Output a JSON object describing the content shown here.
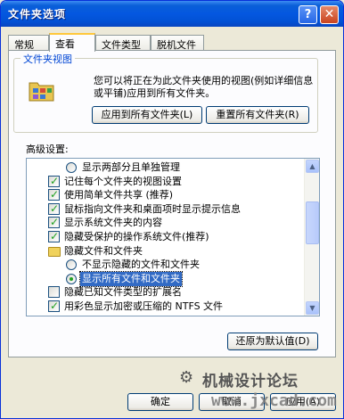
{
  "window": {
    "title": "文件夹选项"
  },
  "titlebar": {
    "help": "?",
    "close": "✕"
  },
  "tabs": [
    "常规",
    "查看",
    "文件类型",
    "脱机文件"
  ],
  "folder_views": {
    "title": "文件夹视图",
    "description": "您可以将正在为此文件夹使用的视图(例如详细信息或平铺)应用到所有文件夹。",
    "apply_all": "应用到所有文件夹(L)",
    "reset_all": "重置所有文件夹(R)"
  },
  "advanced": {
    "label": "高级设置:",
    "items": [
      {
        "type": "radio",
        "checked": false,
        "indent": 1,
        "text": "显示两部分且单独管理"
      },
      {
        "type": "checkbox",
        "checked": true,
        "indent": 0,
        "text": "记住每个文件夹的视图设置"
      },
      {
        "type": "checkbox",
        "checked": true,
        "indent": 0,
        "text": "使用简单文件共享 (推荐)"
      },
      {
        "type": "checkbox",
        "checked": true,
        "indent": 0,
        "text": "鼠标指向文件夹和桌面项时显示提示信息"
      },
      {
        "type": "checkbox",
        "checked": true,
        "indent": 0,
        "text": "显示系统文件夹的内容"
      },
      {
        "type": "checkbox",
        "checked": true,
        "indent": 0,
        "text": "隐藏受保护的操作系统文件(推荐)"
      },
      {
        "type": "folder",
        "checked": false,
        "indent": 0,
        "text": "隐藏文件和文件夹"
      },
      {
        "type": "radio",
        "checked": false,
        "indent": 1,
        "text": "不显示隐藏的文件和文件夹"
      },
      {
        "type": "radio",
        "checked": true,
        "indent": 1,
        "text": "显示所有文件和文件夹",
        "highlight": true
      },
      {
        "type": "checkbox",
        "checked": false,
        "indent": 0,
        "text": "隐藏已知文件类型的扩展名"
      },
      {
        "type": "checkbox",
        "checked": true,
        "indent": 0,
        "text": "用彩色显示加密或压缩的 NTFS 文件"
      }
    ]
  },
  "restore_defaults": "还原为默认值(D)",
  "footer": {
    "ok": "确定",
    "cancel": "取消",
    "apply": "应用(A)"
  },
  "watermark": {
    "cn": "机械设计论坛",
    "url": "www.jxcad.com"
  }
}
